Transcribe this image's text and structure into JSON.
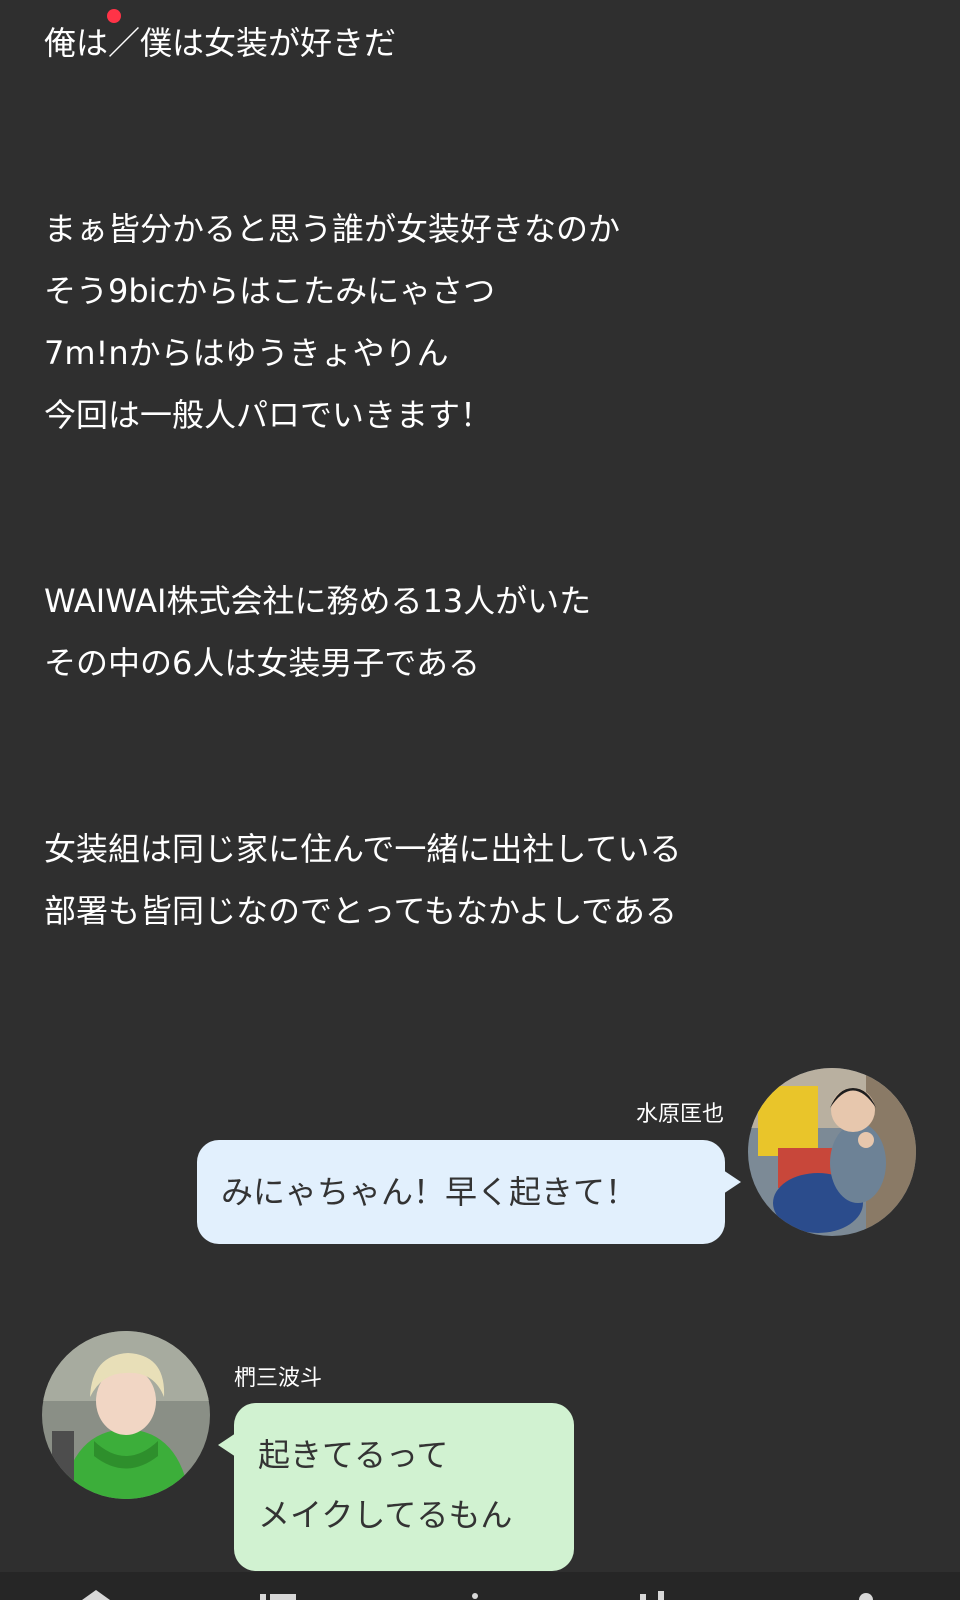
{
  "story": {
    "lines": [
      "俺は／僕は女装が好きだ",
      "",
      "",
      "まぁ皆分かると思う誰が女装好きなのか",
      "そう9bicからはこたみにゃさつ",
      "7m!nからはゆうきょやりん",
      "今回は一般人パロでいきます！",
      "",
      "",
      "WAIWAI株式会社に務める13人がいた",
      "その中の6人は女装男子である",
      "",
      "",
      "女装組は同じ家に住んで一緒に出社している",
      "部署も皆同じなのでとってもなかよしである"
    ]
  },
  "chat": {
    "message1": {
      "speaker": "水原匡也",
      "lines": [
        "みにゃちゃん！早く起きて！"
      ],
      "bubble_color": "#e2f0fd"
    },
    "message2": {
      "speaker": "椚三波斗",
      "lines": [
        "起きてるって",
        "メイクしてるもん"
      ],
      "bubble_color": "#d1f2d1"
    }
  },
  "nav": {
    "icons": [
      "home-icon",
      "list-icon",
      "pen-icon",
      "bars-icon",
      "user-icon"
    ]
  },
  "colors": {
    "background": "#2f2f2f",
    "notification_dot": "#ff3347",
    "text": "#ffffff"
  }
}
